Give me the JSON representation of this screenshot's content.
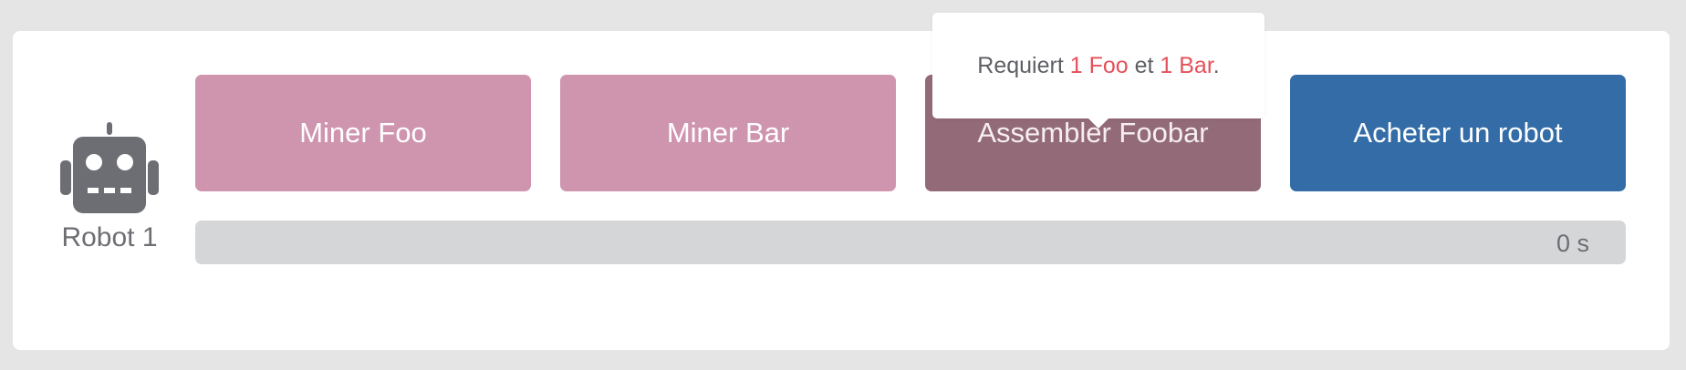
{
  "robot": {
    "name": "Robot 1",
    "icon": "robot-icon"
  },
  "actions": {
    "mine_foo": "Miner Foo",
    "mine_bar": "Miner Bar",
    "assemble_foobar": "Assembler Foobar",
    "buy_robot": "Acheter un robot"
  },
  "progress": {
    "label": "0 s",
    "value": 0
  },
  "tooltip": {
    "prefix": "Requiert ",
    "foo": "1 Foo",
    "middle": " et ",
    "bar": "1 Bar",
    "suffix": "."
  },
  "colors": {
    "mine_button": "#cf95ae",
    "assemble_button": "#926a78",
    "buy_button": "#336ca6",
    "requirement_text": "#e5515a",
    "progress_track": "#d5d6d8"
  }
}
